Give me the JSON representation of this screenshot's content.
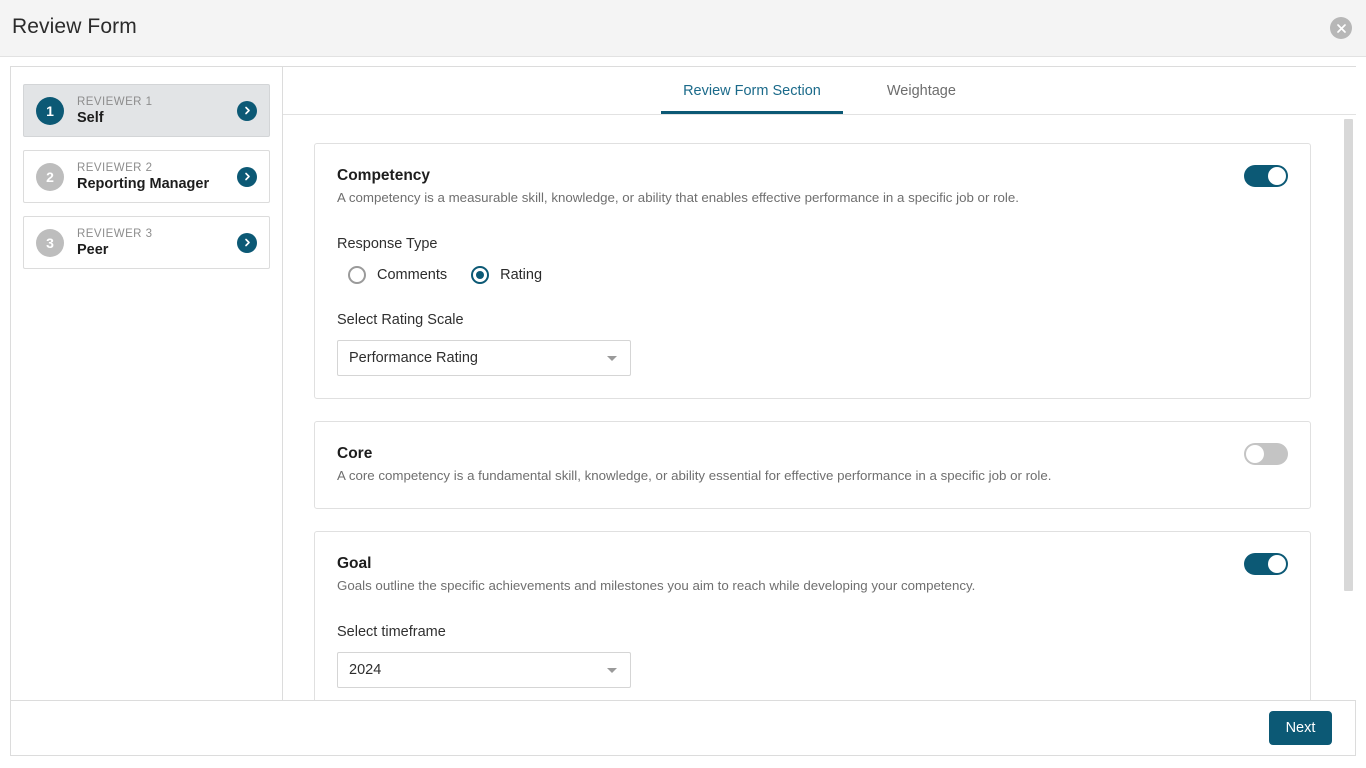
{
  "window": {
    "title": "Review Form",
    "close_icon": "close-circle-icon"
  },
  "sidebar": {
    "items": [
      {
        "badge": "1",
        "eyebrow": "REVIEWER 1",
        "name": "Self",
        "active": true,
        "chevron_icon": "chevron-right-icon"
      },
      {
        "badge": "2",
        "eyebrow": "REVIEWER 2",
        "name": "Reporting Manager",
        "active": false,
        "chevron_icon": "chevron-right-icon"
      },
      {
        "badge": "3",
        "eyebrow": "REVIEWER 3",
        "name": "Peer",
        "active": false,
        "chevron_icon": "chevron-right-icon"
      }
    ]
  },
  "tabs": [
    {
      "label": "Review Form Section",
      "active": true
    },
    {
      "label": "Weightage",
      "active": false
    }
  ],
  "sections": {
    "competency": {
      "title": "Competency",
      "description": "A competency is a measurable skill, knowledge, or ability that enables effective performance in a specific job or role.",
      "toggle_state": "on",
      "response_type_label": "Response Type",
      "options": [
        {
          "label": "Comments",
          "selected": false
        },
        {
          "label": "Rating",
          "selected": true
        }
      ],
      "rating_scale_label": "Select Rating Scale",
      "rating_scale_value": "Performance Rating",
      "caret_icon": "chevron-down-icon"
    },
    "core": {
      "title": "Core",
      "description": "A core competency is a fundamental skill, knowledge, or ability essential for effective performance in a specific job or role.",
      "toggle_state": "off"
    },
    "goal": {
      "title": "Goal",
      "description": "Goals outline the specific achievements and milestones you aim to reach while developing your competency.",
      "toggle_state": "on",
      "timeframe_label": "Select timeframe",
      "timeframe_value": "2024",
      "caret_icon": "chevron-down-icon"
    }
  },
  "footer": {
    "next_label": "Next"
  },
  "colors": {
    "accent": "#0c5975",
    "toggle_off": "#c4c4c4",
    "header_bg": "#f4f4f4"
  }
}
